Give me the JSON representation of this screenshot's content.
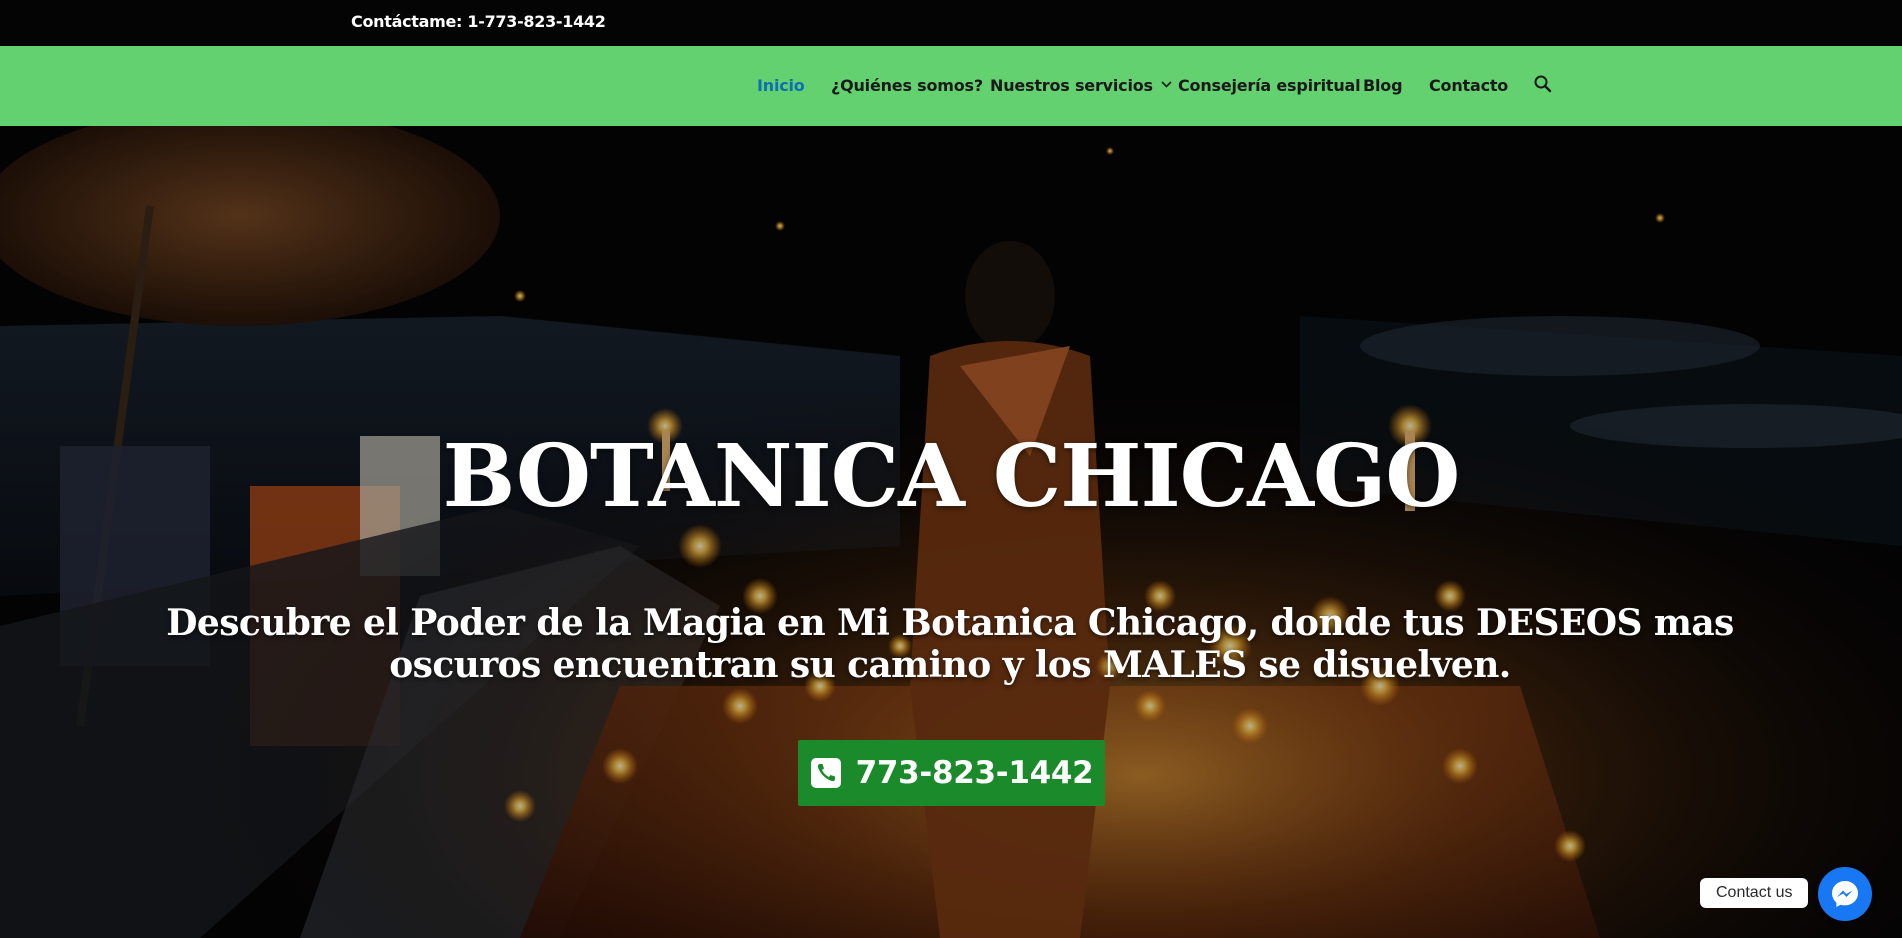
{
  "topbar": {
    "contact_text": "Contáctame: 1-773-823-1442"
  },
  "nav": {
    "items": [
      {
        "label": "Inicio",
        "active": true
      },
      {
        "label": "¿Quiénes somos?"
      },
      {
        "label": "Nuestros servicios",
        "has_dropdown": true
      },
      {
        "label": "Consejería espiritual"
      },
      {
        "label": "Blog"
      },
      {
        "label": "Contacto"
      }
    ],
    "search_icon": "search-icon",
    "background_color": "#63d170",
    "active_color": "#0f6fb3"
  },
  "hero": {
    "title": "BOTANICA CHICAGO",
    "subtitle": "Descubre el Poder de la Magia en Mi Botanica Chicago, donde tus DESEOS mas oscuros encuentran su camino y los MALES se disuelven.",
    "cta_phone": "773-823-1442",
    "cta_icon": "phone-icon",
    "cta_color": "#1b8a2a"
  },
  "chat": {
    "label": "Contact us",
    "icon": "messenger-icon",
    "color": "#1877f2"
  }
}
